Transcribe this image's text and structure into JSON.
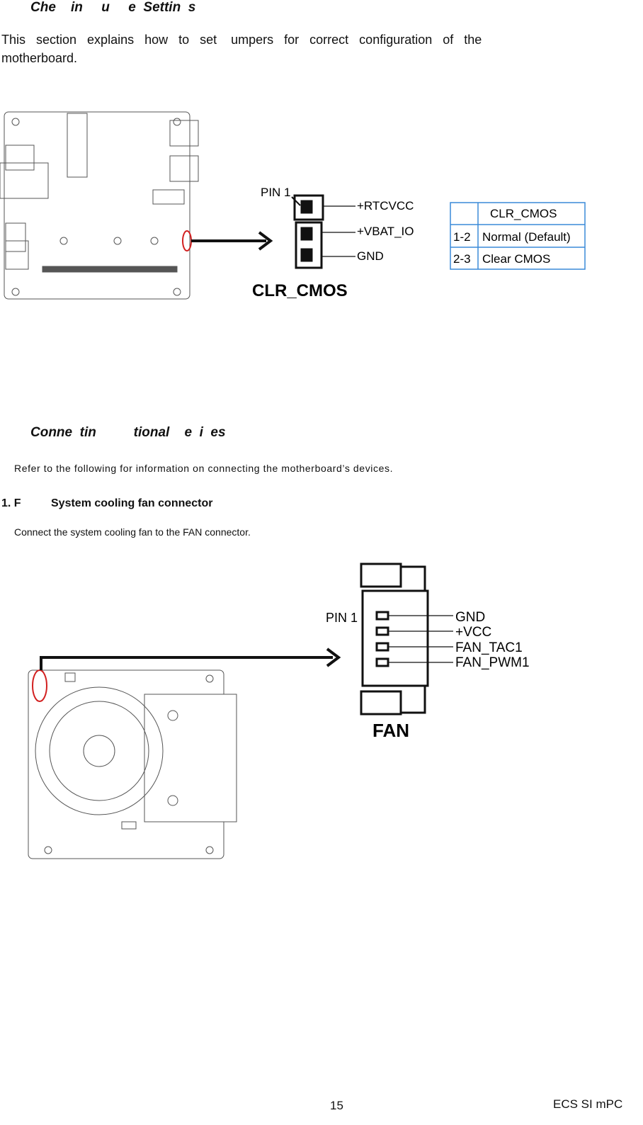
{
  "section1": {
    "heading": "Che    in     u     e  Settin  s",
    "text_line1": "This   section   explains   how   to   set    umpers   for   correct   configuration   of   the",
    "text_line2": "motherboard."
  },
  "clr_cmos": {
    "pin1_label": "PIN 1",
    "pins": [
      "+RTCVCC",
      "+VBAT_IO",
      "GND"
    ],
    "title": "CLR_CMOS",
    "table": {
      "header": [
        "",
        "CLR_CMOS"
      ],
      "rows": [
        [
          "1-2",
          "Normal (Default)"
        ],
        [
          "2-3",
          "Clear CMOS"
        ]
      ]
    }
  },
  "section2": {
    "heading": "Conne  tin          tional    e  i  es",
    "intro": "Refer to the following for information on connecting the motherboard’s devices.",
    "item_number": "1. F",
    "item_title": "System cooling fan connector",
    "item_text": "Connect the system cooling fan to the FAN connector."
  },
  "fan": {
    "pin1_label": "PIN 1",
    "pins": [
      "GND",
      "+VCC",
      "FAN_TAC1",
      "FAN_PWM1"
    ],
    "title": "FAN"
  },
  "footer": {
    "page_number": "15",
    "product": "ECS SI mPC"
  },
  "colors": {
    "highlight": "#d22020",
    "line": "#111111",
    "table_border": "#3a8ad8"
  }
}
